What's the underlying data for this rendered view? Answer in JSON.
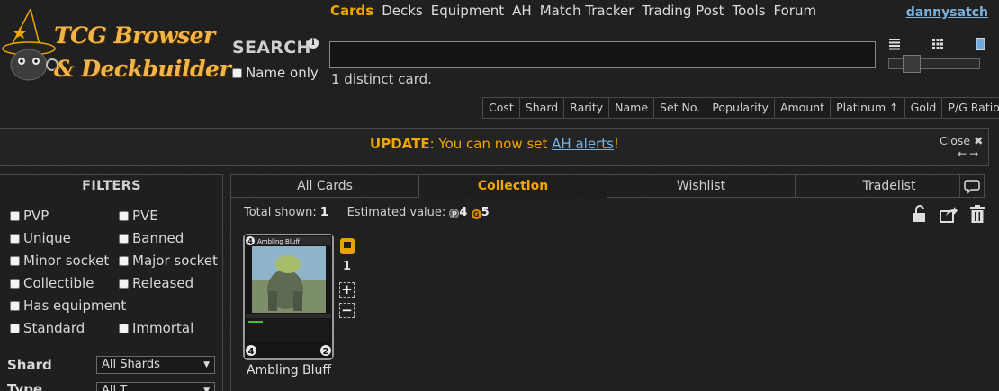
{
  "logo": {
    "line1": "TCG Browser",
    "line2": "& Deckbuilder"
  },
  "nav": [
    "Cards",
    "Decks",
    "Equipment",
    "AH",
    "Match Tracker",
    "Trading Post",
    "Tools",
    "Forum"
  ],
  "nav_active": "Cards",
  "user": {
    "name": "dannysatch"
  },
  "search": {
    "label": "SEARCH",
    "info_glyph": "i",
    "name_only_label": "Name only",
    "value": "",
    "result_text": "1 distinct card."
  },
  "sort_columns": [
    "Cost",
    "Shard",
    "Rarity",
    "Name",
    "Set No.",
    "Popularity",
    "Amount",
    "Platinum ↑",
    "Gold",
    "P/G Ratio"
  ],
  "update": {
    "label": "UPDATE",
    "message": ": You can now set ",
    "link": "AH alerts",
    "tail": "!",
    "close_label": "Close",
    "close_glyph": "✖",
    "prev_glyph": "←",
    "next_glyph": "→"
  },
  "filters": {
    "title": "FILTERS",
    "options": [
      [
        "PVP",
        "PVE"
      ],
      [
        "Unique",
        "Banned"
      ],
      [
        "Minor socket",
        "Major socket"
      ],
      [
        "Collectible",
        "Released"
      ],
      [
        "Has equipment",
        ""
      ],
      [
        "Standard",
        "Immortal"
      ]
    ],
    "shard_label": "Shard",
    "shard_value": "All Shards",
    "type_label": "Type",
    "type_value": "All T",
    "caret_glyph": "▼"
  },
  "tabs": [
    "All Cards",
    "Collection",
    "Wishlist",
    "Tradelist"
  ],
  "active_tab": "Collection",
  "collection": {
    "total_label": "Total shown:",
    "total_value": "1",
    "estimated_label": "Estimated value:",
    "platinum_glyph": "P",
    "platinum_value": "4",
    "gold_glyph": "G",
    "gold_value": "5"
  },
  "card": {
    "name": "Ambling Bluff",
    "title_on_card": "Ambling Bluff",
    "cost": "4",
    "attack": "4",
    "defense": "2",
    "count": "1",
    "plus_glyph": "+",
    "minus_glyph": "−"
  },
  "colors": {
    "accent": "#f0a500",
    "link": "#7ab3df",
    "border": "#4a4a4a",
    "background": "#1e1e1e"
  },
  "icons": {
    "view": [
      "list-view-icon",
      "grid-view-icon",
      "card-view-icon"
    ],
    "tools": [
      "lock-icon",
      "share-icon",
      "trash-icon"
    ],
    "chat": "chat-icon",
    "card_tag": "tag-icon"
  }
}
